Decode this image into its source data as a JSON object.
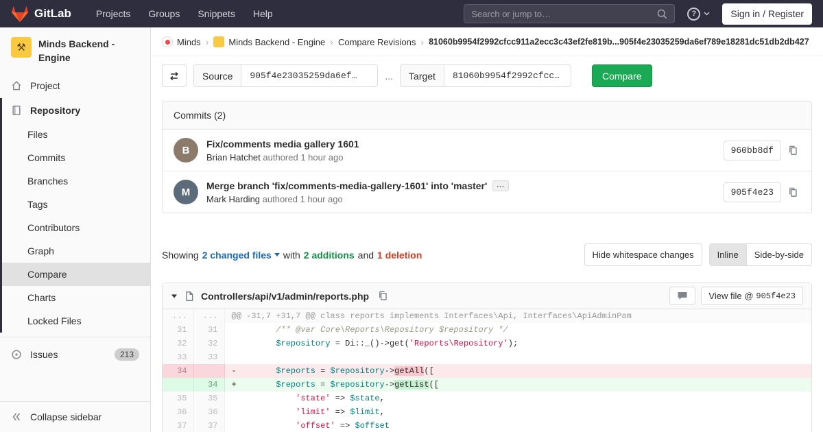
{
  "colors": {
    "navbar_bg": "#2e2e3f",
    "brand_red": "#e24329",
    "brand_orange": "#fc6d26",
    "success_green": "#1aaa55",
    "link_blue": "#1b69b6",
    "danger_red": "#db3b21",
    "diff_add_bg": "#ecfdf0",
    "diff_del_bg": "#fbe9eb"
  },
  "navbar": {
    "brand": "GitLab",
    "links": [
      "Projects",
      "Groups",
      "Snippets",
      "Help"
    ],
    "search_placeholder": "Search or jump to…",
    "help_glyph": "?",
    "sign_in": "Sign in / Register"
  },
  "sidebar": {
    "project_name": "Minds Backend - Engine",
    "project_avatar_glyph": "⚒",
    "project_item": "Project",
    "repository_item": "Repository",
    "repo_subitems": [
      "Files",
      "Commits",
      "Branches",
      "Tags",
      "Contributors",
      "Graph",
      "Compare",
      "Charts",
      "Locked Files"
    ],
    "issues_item": "Issues",
    "issues_count": "213",
    "collapse_label": "Collapse sidebar"
  },
  "breadcrumb": {
    "separator": "›",
    "crumbs": [
      "Minds",
      "Minds Backend - Engine",
      "Compare Revisions"
    ],
    "sha_range": "81060b9954f2992cfcc911a2ecc3c43ef2fe819b...905f4e23035259da6ef789e18281dc51db2db427"
  },
  "compare_form": {
    "source_label": "Source",
    "source_value": "905f4e23035259da6ef…",
    "separator": "...",
    "target_label": "Target",
    "target_value": "81060b9954f2992cfcc…",
    "compare_button": "Compare"
  },
  "commits": {
    "header": "Commits (2)",
    "items": [
      {
        "initial": "B",
        "title": "Fix/comments media gallery 1601",
        "author": "Brian Hatchet",
        "meta": "authored 1 hour ago",
        "sha": "960bb8df"
      },
      {
        "initial": "M",
        "title": "Merge branch 'fix/comments-media-gallery-1601' into 'master'",
        "expander": "...",
        "author": "Mark Harding",
        "meta": "authored 1 hour ago",
        "sha": "905f4e23"
      }
    ]
  },
  "diff_summary": {
    "showing": "Showing",
    "files_link": "2 changed files",
    "with_text": "with",
    "additions_text": "2 additions",
    "and_text": "and",
    "deletions_text": "1 deletion",
    "hide_whitespace": "Hide whitespace changes",
    "inline": "Inline",
    "side_by_side": "Side-by-side"
  },
  "diff_file": {
    "path": "Controllers/api/v1/admin/reports.php",
    "view_file_label": "View file @",
    "view_file_sha": "905f4e23",
    "lines": [
      {
        "type": "hunk",
        "old": "...",
        "new": "...",
        "tokens": [
          {
            "t": "@@ -31,7 +31,7 @@ class reports implements Interfaces\\Api, Interfaces\\ApiAdminPam"
          }
        ]
      },
      {
        "type": "context",
        "old": "31",
        "new": "31",
        "tokens": [
          {
            "t": "         "
          },
          {
            "t": "/** @var Core\\Reports\\Repository $repository */",
            "c": "cmt"
          }
        ]
      },
      {
        "type": "context",
        "old": "32",
        "new": "32",
        "tokens": [
          {
            "t": "         "
          },
          {
            "t": "$repository",
            "c": "var"
          },
          {
            "t": " = Di::_()->"
          },
          {
            "t": "get",
            "c": "fn"
          },
          {
            "t": "("
          },
          {
            "t": "'Reports\\Repository'",
            "c": "str"
          },
          {
            "t": ");"
          }
        ]
      },
      {
        "type": "context",
        "old": "33",
        "new": "33",
        "tokens": [
          {
            "t": ""
          }
        ]
      },
      {
        "type": "del",
        "old": "34",
        "new": "",
        "tokens": [
          {
            "t": "-        "
          },
          {
            "t": "$reports",
            "c": "var"
          },
          {
            "t": " = "
          },
          {
            "t": "$repository",
            "c": "var"
          },
          {
            "t": "->"
          },
          {
            "t": "getAll",
            "c": "hl-del"
          },
          {
            "t": "(["
          }
        ]
      },
      {
        "type": "add",
        "old": "",
        "new": "34",
        "tokens": [
          {
            "t": "+        "
          },
          {
            "t": "$reports",
            "c": "var"
          },
          {
            "t": " = "
          },
          {
            "t": "$repository",
            "c": "var"
          },
          {
            "t": "->"
          },
          {
            "t": "getList",
            "c": "hl-add"
          },
          {
            "t": "(["
          }
        ]
      },
      {
        "type": "context",
        "old": "35",
        "new": "35",
        "tokens": [
          {
            "t": "             "
          },
          {
            "t": "'state'",
            "c": "str"
          },
          {
            "t": " => "
          },
          {
            "t": "$state",
            "c": "var"
          },
          {
            "t": ","
          }
        ]
      },
      {
        "type": "context",
        "old": "36",
        "new": "36",
        "tokens": [
          {
            "t": "             "
          },
          {
            "t": "'limit'",
            "c": "str"
          },
          {
            "t": " => "
          },
          {
            "t": "$limit",
            "c": "var"
          },
          {
            "t": ","
          }
        ]
      },
      {
        "type": "context",
        "old": "37",
        "new": "37",
        "tokens": [
          {
            "t": "             "
          },
          {
            "t": "'offset'",
            "c": "str"
          },
          {
            "t": " => "
          },
          {
            "t": "$offset",
            "c": "var"
          }
        ]
      }
    ]
  }
}
